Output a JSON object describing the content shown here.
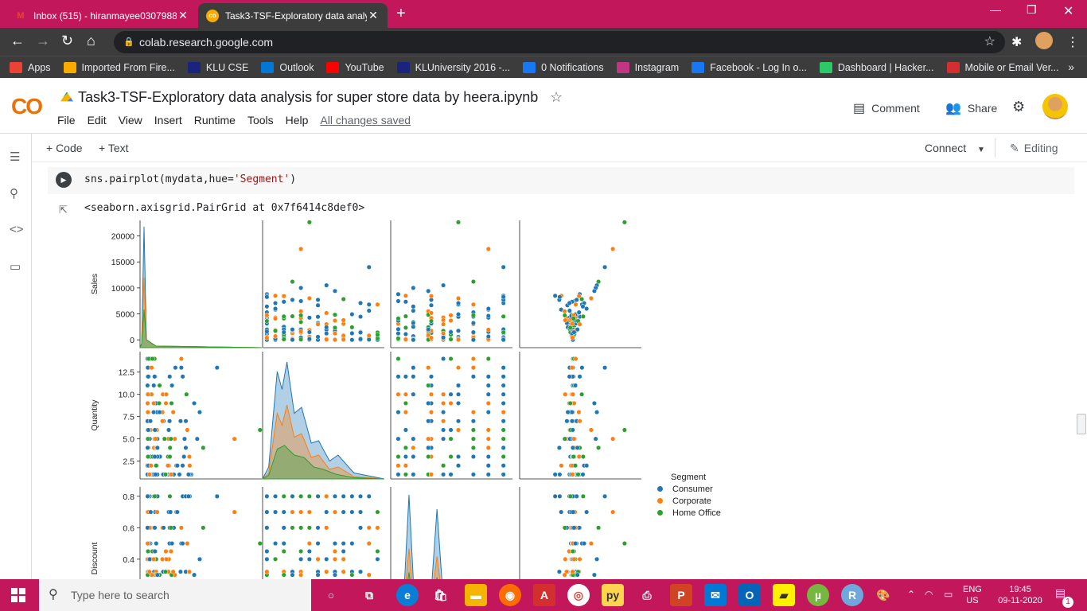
{
  "browser": {
    "tabs": [
      {
        "title": "Inbox (515) - hiranmayee0307988",
        "active": false
      },
      {
        "title": "Task3-TSF-Exploratory data analy",
        "active": true
      }
    ],
    "url": "colab.research.google.com",
    "bookmarks": [
      {
        "label": "Apps",
        "icon": "apps-grid-icon",
        "color": "#ea4335"
      },
      {
        "label": "Imported From Fire...",
        "icon": "folder-icon",
        "color": "#f9ab00"
      },
      {
        "label": "KLU CSE",
        "icon": "klu-icon",
        "color": "#1a237e"
      },
      {
        "label": "Outlook",
        "icon": "windows-icon",
        "color": "#0078d4"
      },
      {
        "label": "YouTube",
        "icon": "youtube-icon",
        "color": "#ff0000"
      },
      {
        "label": "KLUniversity 2016 -...",
        "icon": "klu-icon",
        "color": "#1a237e"
      },
      {
        "label": "0 Notifications",
        "icon": "facebook-icon",
        "color": "#1877f2"
      },
      {
        "label": "Instagram",
        "icon": "instagram-icon",
        "color": "#c13584"
      },
      {
        "label": "Facebook - Log In o...",
        "icon": "facebook-icon",
        "color": "#1877f2"
      },
      {
        "label": "Dashboard | Hacker...",
        "icon": "hackerrank-icon",
        "color": "#2ec866"
      },
      {
        "label": "Mobile or Email Ver...",
        "icon": "diamond-icon",
        "color": "#d32f2f"
      }
    ]
  },
  "colab": {
    "logo": "CO",
    "notebook_title": "Task3-TSF-Exploratory data analysis for super store data by heera.ipynb",
    "menu": [
      "File",
      "Edit",
      "View",
      "Insert",
      "Runtime",
      "Tools",
      "Help"
    ],
    "save_status": "All changes saved",
    "comment_label": "Comment",
    "share_label": "Share",
    "add_code": "+ Code",
    "add_text": "+ Text",
    "connect_label": "Connect",
    "editing_label": "Editing"
  },
  "cell": {
    "code_prefix": "sns.pairplot(mydata,hue=",
    "code_string": "'Segment'",
    "code_suffix": ")",
    "output_text": "<seaborn.axisgrid.PairGrid at 0x7f6414c8def0>"
  },
  "chart_data": {
    "type": "scatter",
    "title": "",
    "variables": [
      "Sales",
      "Quantity",
      "Discount"
    ],
    "hue": "Segment",
    "legend_title": "Segment",
    "series": [
      {
        "name": "Consumer",
        "color": "#1f77b4"
      },
      {
        "name": "Corporate",
        "color": "#ff7f0e"
      },
      {
        "name": "Home Office",
        "color": "#2ca02c"
      }
    ],
    "axes": {
      "Sales": {
        "label": "Sales",
        "ticks": [
          0,
          5000,
          10000,
          15000,
          20000
        ],
        "lim": [
          -1500,
          23000
        ]
      },
      "Quantity": {
        "label": "Quantity",
        "ticks": [
          2.5,
          5.0,
          7.5,
          10.0,
          12.5
        ],
        "tick_labels": [
          "2.5",
          "5.0",
          "7.5",
          "10.0",
          "12.5"
        ],
        "lim": [
          0.5,
          14.8
        ]
      },
      "Discount": {
        "label": "Discount",
        "ticks": [
          0.4,
          0.6,
          0.8
        ],
        "tick_labels": [
          "0.4",
          "0.6",
          "0.8"
        ],
        "lim": [
          0.05,
          0.86
        ]
      }
    },
    "sample_points": [
      {
        "sales": 22638,
        "quantity": 6,
        "discount": 0.5,
        "segment": "Home Office"
      },
      {
        "sales": 17500,
        "quantity": 5,
        "discount": 0.7,
        "segment": "Corporate"
      },
      {
        "sales": 14000,
        "quantity": 13,
        "discount": 0.8,
        "segment": "Consumer"
      },
      {
        "sales": 11200,
        "quantity": 4,
        "discount": 0.6,
        "segment": "Home Office"
      },
      {
        "sales": 10500,
        "quantity": 8,
        "discount": 0.4,
        "segment": "Consumer"
      },
      {
        "sales": 10000,
        "quantity": 5,
        "discount": 0.2,
        "segment": "Consumer"
      },
      {
        "sales": 9400,
        "quantity": 9,
        "discount": 0.3,
        "segment": "Consumer"
      },
      {
        "sales": 8000,
        "quantity": 6,
        "discount": 0.5,
        "segment": "Corporate"
      },
      {
        "sales": 6000,
        "quantity": 2,
        "discount": 0.7,
        "segment": "Consumer"
      },
      {
        "sales": 4500,
        "quantity": 3,
        "discount": 0.8,
        "segment": "Home Office"
      },
      {
        "sales": 3000,
        "quantity": 7,
        "discount": 0.4,
        "segment": "Corporate"
      },
      {
        "sales": 2000,
        "quantity": 4,
        "discount": 0.3,
        "segment": "Consumer"
      }
    ]
  },
  "taskbar": {
    "search_placeholder": "Type here to search",
    "lang": "ENG",
    "region": "US",
    "time": "19:45",
    "date": "09-11-2020",
    "notification_count": "1"
  }
}
